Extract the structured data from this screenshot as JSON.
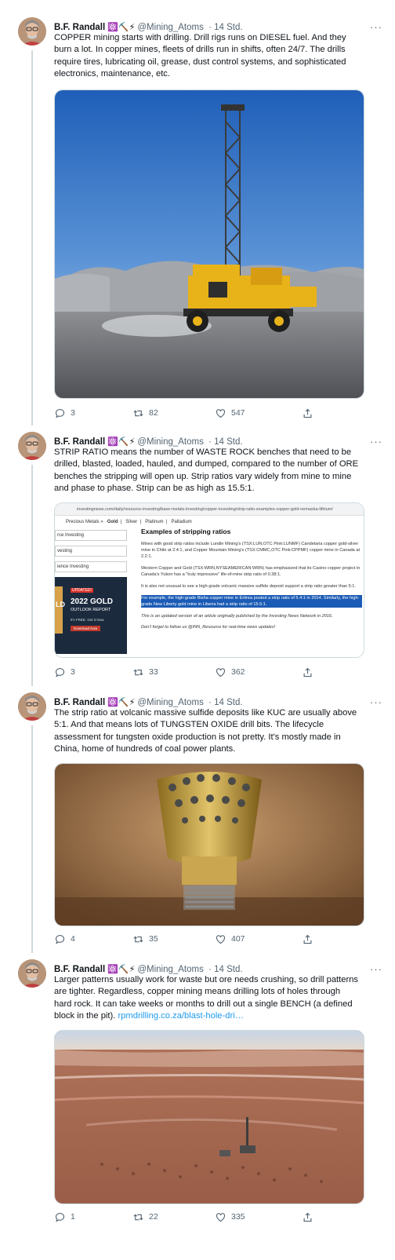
{
  "author": {
    "name": "B.F. Randall",
    "badges": "⚛️⛏️⚡",
    "handle": "@Mining_Atoms",
    "time": "· 14 Std.",
    "more": "···"
  },
  "tweets": [
    {
      "text": "COPPER mining starts with drilling. Drill rigs runs on DIESEL fuel. And they burn a lot. In copper mines, fleets of drills run in shifts, often 24/7. The drills require tires, lubricating oil, grease, dust control systems, and sophisticated electronics, maintenance, etc.",
      "replies": "3",
      "retweets": "82",
      "likes": "547"
    },
    {
      "text": "STRIP RATIO means the number of WASTE ROCK benches that need to be drilled, blasted, loaded, hauled, and dumped, compared to the number of ORE benches the stripping will open up. Strip ratios vary widely from mine to mine and phase to phase. Strip can be as high as 15.5:1.",
      "replies": "3",
      "retweets": "33",
      "likes": "362"
    },
    {
      "text": "The strip ratio at volcanic massive sulfide deposits like KUC are usually above 5:1. And that means lots of TUNGSTEN OXIDE drill bits. The lifecycle assessment for tungsten oxide production is not pretty. It's mostly made in China, home of hundreds of coal power plants.",
      "replies": "4",
      "retweets": "35",
      "likes": "407"
    },
    {
      "text": "Larger patterns usually work for waste but ore needs crushing, so drill patterns are tighter. Regardless, copper mining means drilling lots of holes through hard rock. It can take weeks or months to drill out a single BENCH (a defined block in the pit).",
      "link": "rpmdrilling.co.za/blast-hole-dri…",
      "replies": "1",
      "retweets": "22",
      "likes": "335"
    }
  ],
  "screenshot": {
    "url": "investingnews.com/daily/resource-investing/base-metals-investing/copper-investing/strip-ratio-examples-copper-gold-nemaska-lithium/",
    "nav": [
      "Precious Metals »",
      "Gold",
      "Silver",
      "Platinum",
      "Palladium"
    ],
    "sidebar": [
      "rce Investing",
      "vesting",
      "ience Investing"
    ],
    "ad": {
      "tag": "UPDATED!",
      "title": "2022 GOLD",
      "subtitle": "OUTLOOK REPORT",
      "sub": "It's FREE. Get it Now.",
      "button": "Download Now",
      "brand": "LD"
    },
    "heading": "Examples of stripping ratios",
    "p1": "Mines with good strip ratios include Lundin Mining's (TSX:LUN,OTC Pink:LUNMF) Candelaria copper gold-silver mine in Chile at 2.4:1, and Copper Mountain Mining's (TSX:CMMC,OTC Pink:CPPMF) copper mine in Canada at 2.2:1.",
    "p2": "Western Copper and Gold (TSX:WRN,NYSEAMERICAN:WRN) has emphasized that its Casino copper project in Canada's Yukon has a \"truly impressive\" life-of-mine strip ratio of 0.38:1.",
    "p3": "It is also not unusual to see a high-grade volcanic massive sulfide deposit support a strip ratio greater than 5:1.",
    "highlight": "For example, the high-grade Bisha copper mine in Eritrea posted a strip ratio of 5.4:1 in 2014. Similarly, the high-grade New Liberty gold mine in Liberia had a strip ratio of 15.5:1.",
    "p4": "This is an updated version of an article originally published by the Investing News Network in 2016.",
    "p5": "Don't forget to follow us @INN_Resource for real-time news updates!"
  },
  "colors": {
    "accent": "#1d9bf0",
    "muted": "#536471",
    "highlight": "#1a5bb5"
  },
  "icons": [
    "reply-icon",
    "retweet-icon",
    "like-icon",
    "share-icon",
    "more-icon"
  ]
}
